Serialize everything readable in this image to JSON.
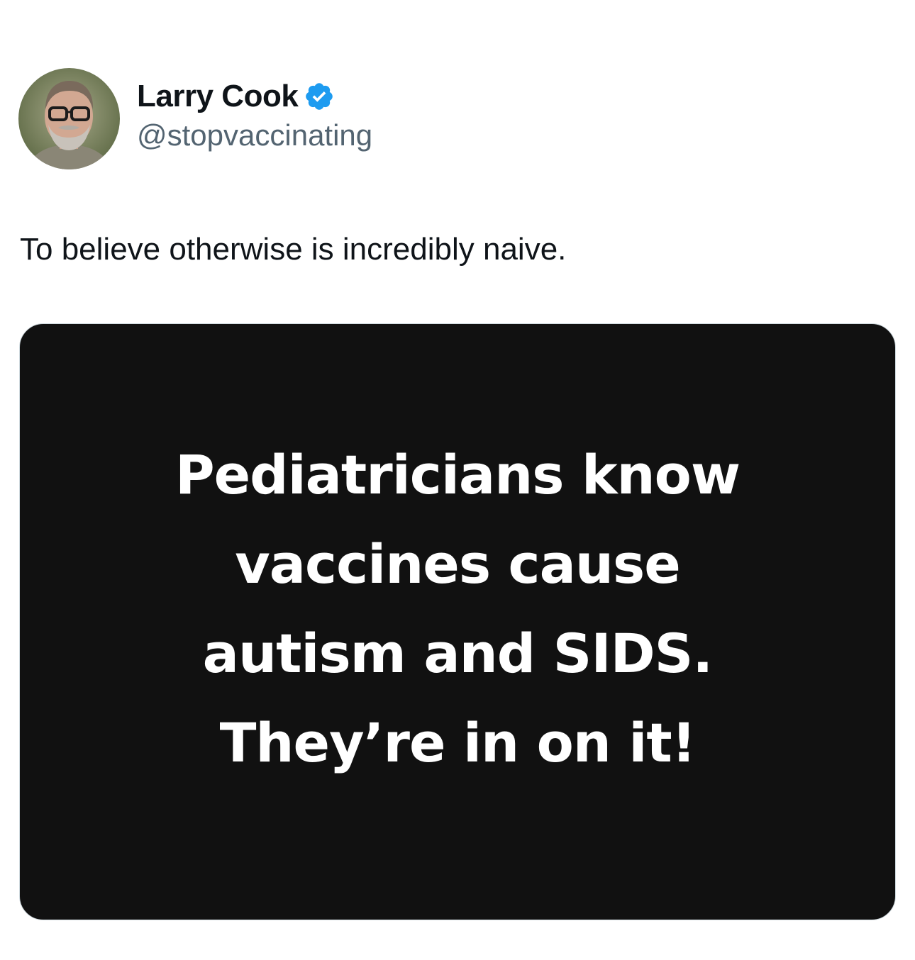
{
  "author": {
    "display_name": "Larry Cook",
    "handle": "@stopvaccinating",
    "verified": true,
    "verified_icon": "verified-badge-icon",
    "verified_color": "#1d9bf0"
  },
  "tweet": {
    "text": "To believe otherwise is incredibly naive."
  },
  "media": {
    "background_color": "#111111",
    "text_color": "#ffffff",
    "lines": [
      "Pediatricians know",
      "vaccines cause",
      "autism and SIDS.",
      "They’re in on it!"
    ]
  }
}
